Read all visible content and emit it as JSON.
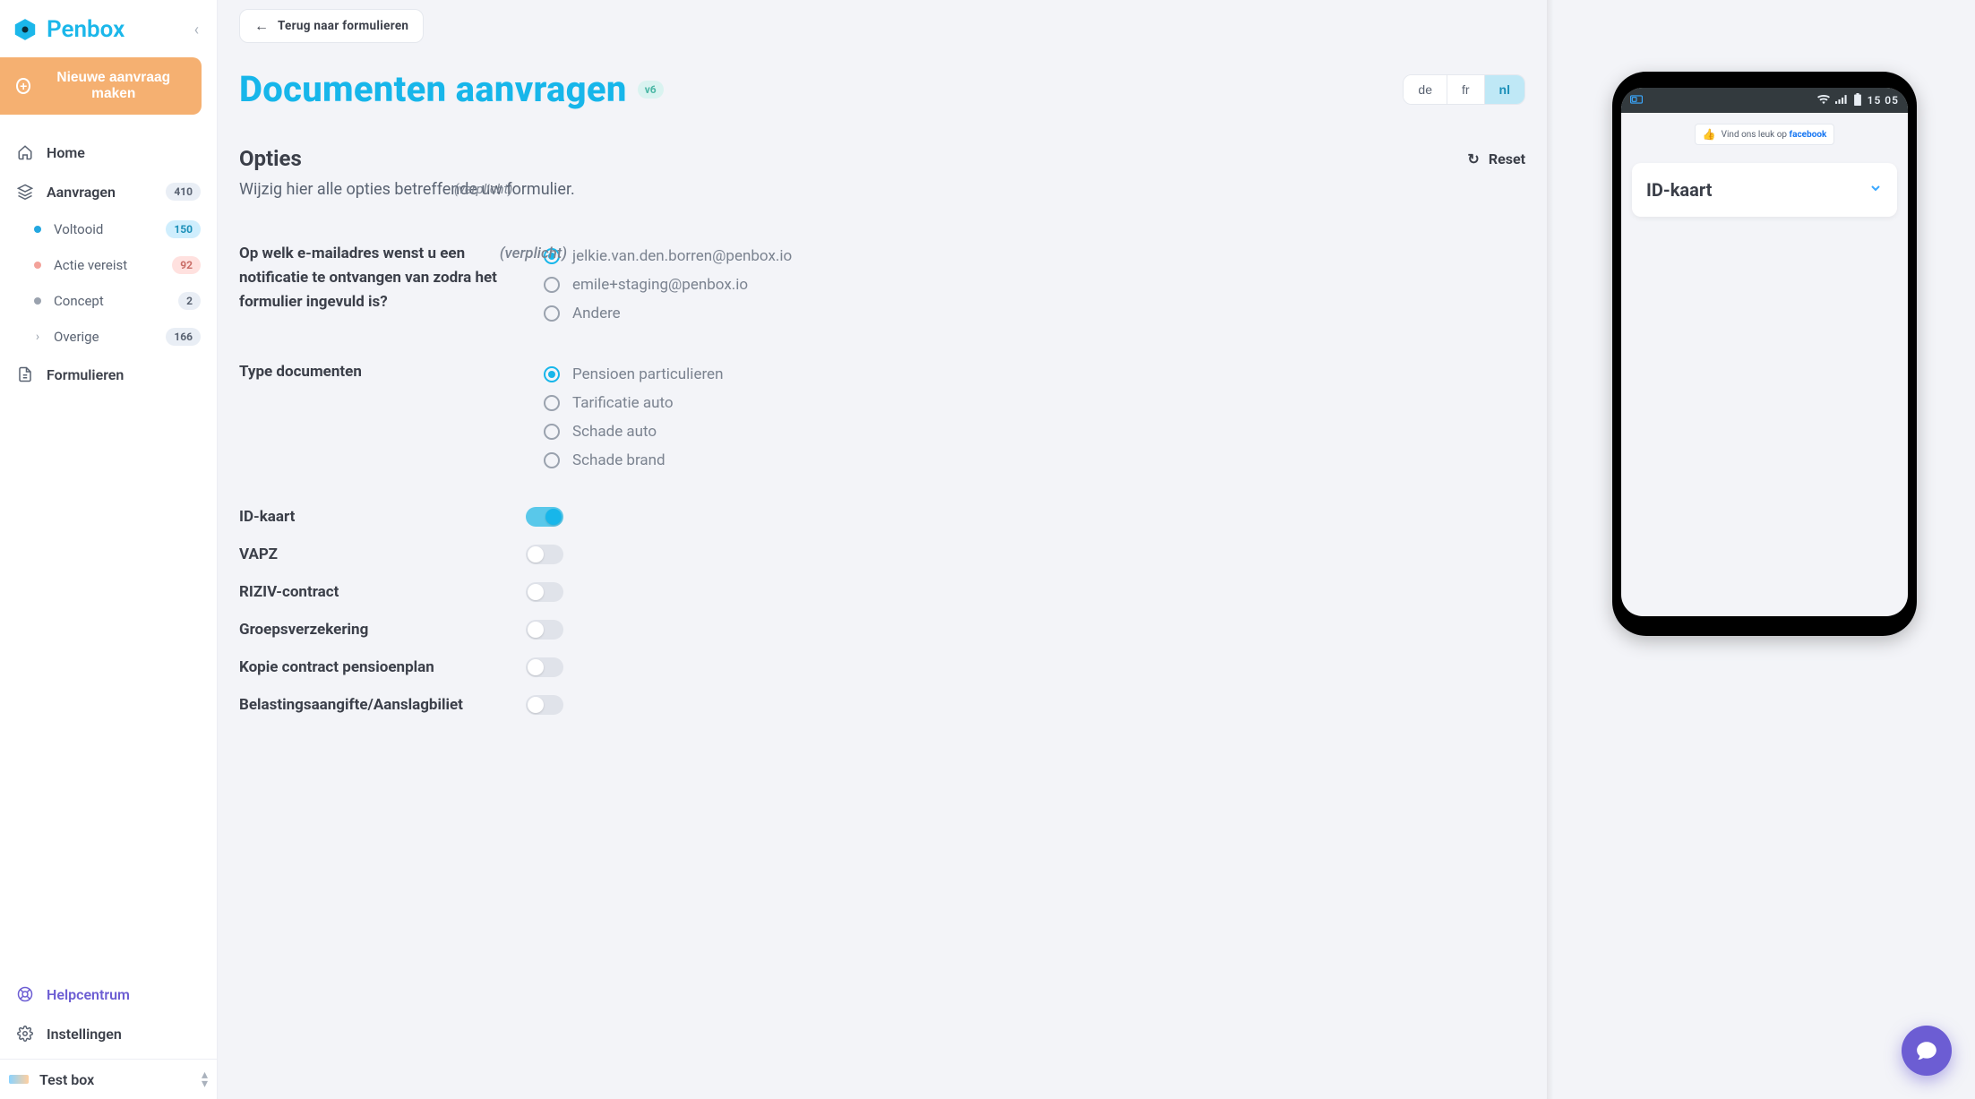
{
  "brand": {
    "name": "Penbox"
  },
  "sidebar": {
    "new_request": "Nieuwe aanvraag maken",
    "items": [
      {
        "label": "Home"
      },
      {
        "label": "Aanvragen",
        "badge": "410"
      }
    ],
    "sub": [
      {
        "label": "Voltooid",
        "badge": "150",
        "dot": "blue",
        "badgeClass": "blue"
      },
      {
        "label": "Actie vereist",
        "badge": "92",
        "dot": "coral",
        "badgeClass": "coral"
      },
      {
        "label": "Concept",
        "badge": "2",
        "dot": "grey",
        "badgeClass": ""
      },
      {
        "label": "Overige",
        "badge": "166",
        "caret": true,
        "badgeClass": ""
      }
    ],
    "forms_label": "Formulieren",
    "help_label": "Helpcentrum",
    "settings_label": "Instellingen",
    "org_name": "Test box"
  },
  "header": {
    "back": "Terug naar formulieren",
    "title": "Documenten aanvragen",
    "version": "v6",
    "langs": [
      "de",
      "fr",
      "nl"
    ],
    "active_lang": "nl"
  },
  "options": {
    "title": "Opties",
    "desc": "Wijzig hier alle opties betreffende uw formulier.",
    "reset": "Reset"
  },
  "q_email": {
    "text": "Op welk e-mailadres wenst u een notificatie te ontvangen van zodra het formulier ingevuld is?",
    "required": "(verplicht)",
    "options": [
      {
        "label": "jelkie.van.den.borren@penbox.io",
        "checked": true
      },
      {
        "label": "emile+staging@penbox.io",
        "checked": false
      },
      {
        "label": "Andere",
        "checked": false
      }
    ]
  },
  "q_doctype": {
    "text": "Type documenten",
    "options": [
      {
        "label": "Pensioen particulieren",
        "checked": true
      },
      {
        "label": "Tarificatie auto",
        "checked": false
      },
      {
        "label": "Schade auto",
        "checked": false
      },
      {
        "label": "Schade brand",
        "checked": false
      }
    ]
  },
  "toggles": [
    {
      "label": "ID-kaart",
      "on": true
    },
    {
      "label": "VAPZ",
      "on": false
    },
    {
      "label": "RIZIV-contract",
      "on": false
    },
    {
      "label": "Groepsverzekering",
      "on": false
    },
    {
      "label": "Kopie contract pensioenplan",
      "on": false
    },
    {
      "label": "Belastingsaangifte/Aanslagbiliet",
      "on": false
    }
  ],
  "preview": {
    "time": "15 05",
    "fb_text_pre": "Vind ons leuk op ",
    "fb_text_bold": "facebook",
    "card_title": "ID-kaart"
  }
}
